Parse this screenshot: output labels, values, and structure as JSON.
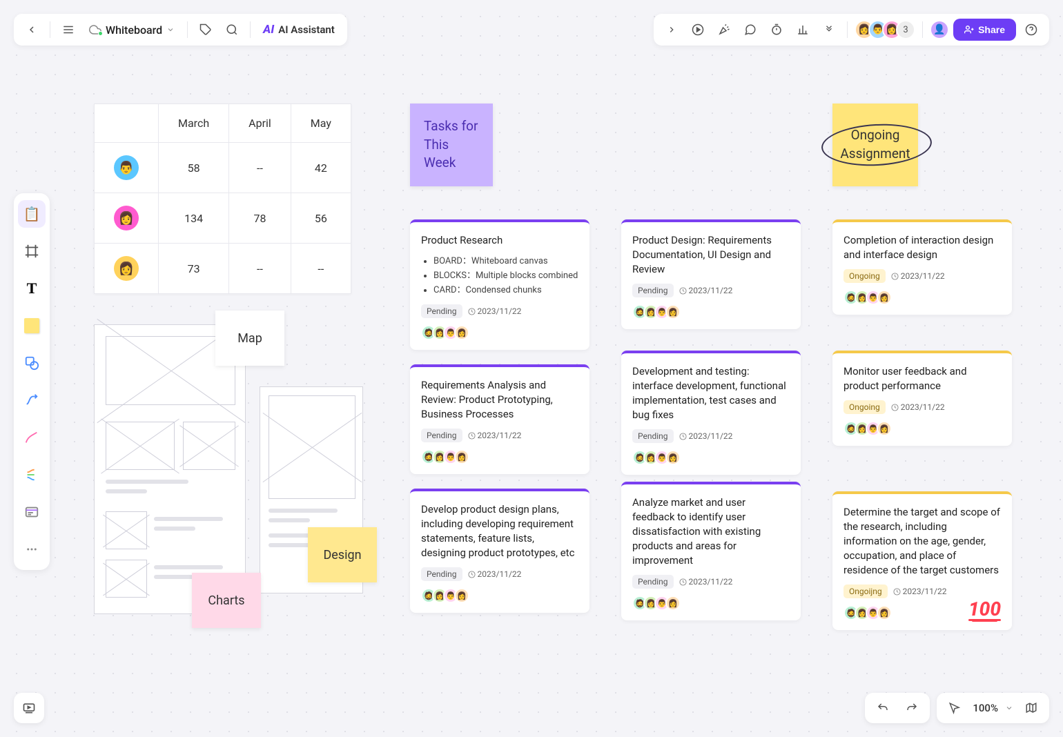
{
  "board_name": "Whiteboard",
  "ai_assistant_label": "AI Assistant",
  "share_label": "Share",
  "avatar_extra_count": "3",
  "zoom_level": "100%",
  "table": {
    "headers": [
      "",
      "March",
      "April",
      "May"
    ],
    "rows": [
      {
        "avatar_color": "#5bc7ff",
        "cells": [
          "58",
          "--",
          "42"
        ]
      },
      {
        "avatar_color": "#ff5bcf",
        "cells": [
          "134",
          "78",
          "56"
        ]
      },
      {
        "avatar_color": "#ffd25b",
        "cells": [
          "73",
          "--",
          "--"
        ]
      }
    ]
  },
  "sticky_map": "Map",
  "sticky_design": "Design",
  "sticky_charts": "Charts",
  "sticky_tasks": "Tasks for This Week",
  "sticky_ongoing": "Ongoing Assignment",
  "cards_col1": [
    {
      "title": "Product Research",
      "bullets": [
        "BOARD：Whiteboard canvas",
        "BLOCKS：Multiple blocks combined",
        "CARD：Condensed chunks"
      ],
      "status": "Pending",
      "date": "2023/11/22"
    },
    {
      "title": "Requirements Analysis and Review: Product Prototyping, Business Processes",
      "status": "Pending",
      "date": "2023/11/22"
    },
    {
      "title": "Develop product design plans, including developing requirement statements, feature lists, designing product prototypes, etc",
      "status": "Pending",
      "date": "2023/11/22"
    }
  ],
  "cards_col2": [
    {
      "title": "Product Design: Requirements Documentation, UI Design and Review",
      "status": "Pending",
      "date": "2023/11/22"
    },
    {
      "title": "Development and testing: interface development, functional implementation, test cases and bug fixes",
      "status": "Pending",
      "date": "2023/11/22"
    },
    {
      "title": "Analyze market and user feedback to identify user dissatisfaction with existing products and areas for improvement",
      "status": "Pending",
      "date": "2023/11/22"
    }
  ],
  "cards_col3": [
    {
      "title": "Completion of interaction design and interface design",
      "status": "Ongoing",
      "date": "2023/11/22"
    },
    {
      "title": "Monitor user feedback and product performance",
      "status": "Ongoing",
      "date": "2023/11/22"
    },
    {
      "title": "Determine the target and scope of the research, including information on the age, gender, occupation, and place of residence of the target customers",
      "status": "Ongoijng",
      "date": "2023/11/22",
      "hundred": true
    }
  ],
  "avatar_colors": [
    "#b8f0d4",
    "#d4f0b8",
    "#ffd4f0",
    "#ffe0b8"
  ],
  "hundred_label": "100"
}
